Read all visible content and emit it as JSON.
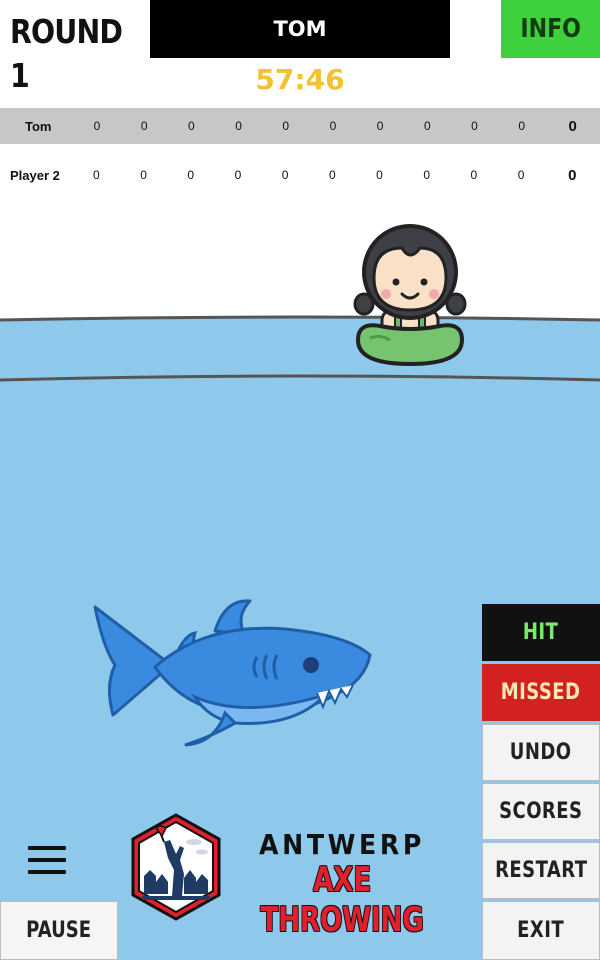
{
  "header": {
    "round_label": "ROUND 1",
    "current_player": "TOM",
    "info_label": "INFO",
    "timer": "57:46"
  },
  "scoreboard": [
    {
      "name": "Tom",
      "scores": [
        "0",
        "0",
        "0",
        "0",
        "0",
        "0",
        "0",
        "0",
        "0",
        "0"
      ],
      "total": "0"
    },
    {
      "name": "Player 2",
      "scores": [
        "0",
        "0",
        "0",
        "0",
        "0",
        "0",
        "0",
        "0",
        "0",
        "0"
      ],
      "total": "0"
    }
  ],
  "controls": {
    "hit": "HIT",
    "missed": "MISSED",
    "undo": "UNDO",
    "scores": "SCORES",
    "restart": "RESTART",
    "exit": "EXIT",
    "pause": "PAUSE"
  },
  "logo": {
    "top": "ANTWERP",
    "bottom": "AXE THROWING"
  },
  "icons": {
    "menu": "hamburger-menu-icon",
    "character": "girl-in-swim-ring",
    "enemy": "shark"
  },
  "colors": {
    "water": "#8ec9ec",
    "info_bg": "#3fd13d",
    "timer": "#f3c132",
    "hit_bg": "#111111",
    "missed_bg": "#d32020",
    "scoreboard_row": "#c7c7c7"
  }
}
